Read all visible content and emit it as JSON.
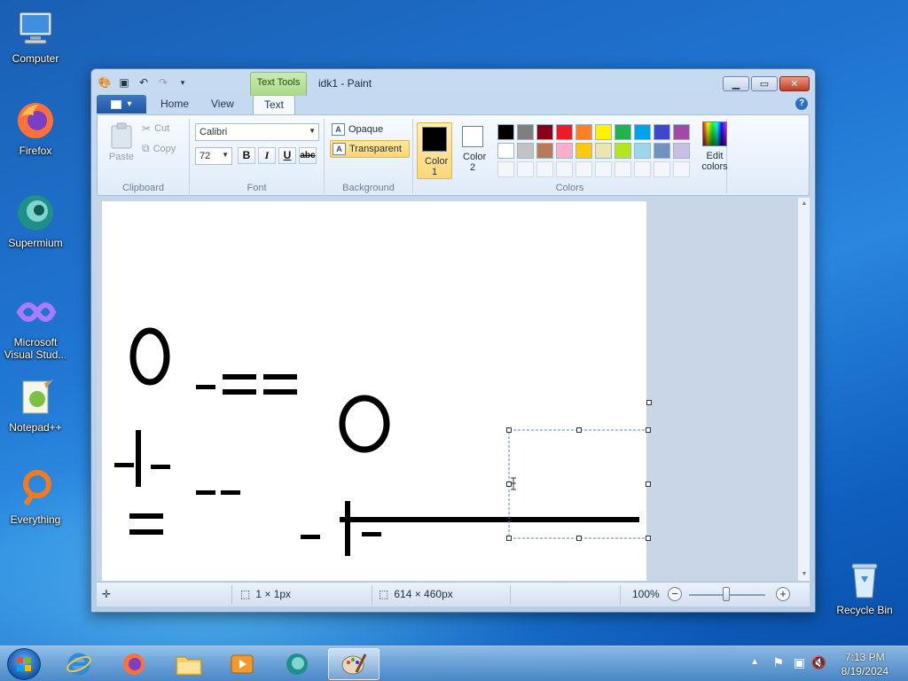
{
  "desktop": {
    "icons": [
      {
        "label": "Computer"
      },
      {
        "label": "Firefox"
      },
      {
        "label": "Supermium"
      },
      {
        "label": "Microsoft Visual Stud..."
      },
      {
        "label": "Notepad++"
      },
      {
        "label": "Everything"
      },
      {
        "label": "Recycle Bin"
      }
    ]
  },
  "window": {
    "title": "idk1 - Paint",
    "context_tab": "Text Tools",
    "tabs": [
      "Home",
      "View",
      "Text"
    ],
    "active_tab": "Text"
  },
  "ribbon": {
    "clipboard": {
      "label": "Clipboard",
      "paste": "Paste",
      "cut": "Cut",
      "copy": "Copy"
    },
    "font": {
      "label": "Font",
      "family": "Calibri",
      "size": "72",
      "bold": "B",
      "italic": "I",
      "underline": "U",
      "strikethrough": "abc"
    },
    "background": {
      "label": "Background",
      "opaque": "Opaque",
      "transparent": "Transparent",
      "selected": "Transparent"
    },
    "colors": {
      "label": "Colors",
      "color1": "Color 1",
      "color2": "Color 2",
      "color1_value": "#000000",
      "color2_value": "#ffffff",
      "edit": "Edit colors",
      "row1": [
        "#000000",
        "#7f7f7f",
        "#880015",
        "#ed1c24",
        "#ff7f27",
        "#fff200",
        "#22b14c",
        "#00a2e8",
        "#3f48cc",
        "#a349a4"
      ],
      "row2": [
        "#ffffff",
        "#c3c3c3",
        "#b97a57",
        "#ffaec9",
        "#ffc90e",
        "#efe4b0",
        "#b5e61d",
        "#99d9ea",
        "#7092be",
        "#c8bfe7"
      ],
      "row3": [
        "",
        "",
        "",
        "",
        "",
        "",
        "",
        "",
        "",
        ""
      ]
    }
  },
  "status": {
    "selection_size": "1 × 1px",
    "image_size": "614 × 460px",
    "zoom": "100%"
  },
  "taskbar": {
    "time": "7:13 PM",
    "date": "8/19/2024"
  }
}
